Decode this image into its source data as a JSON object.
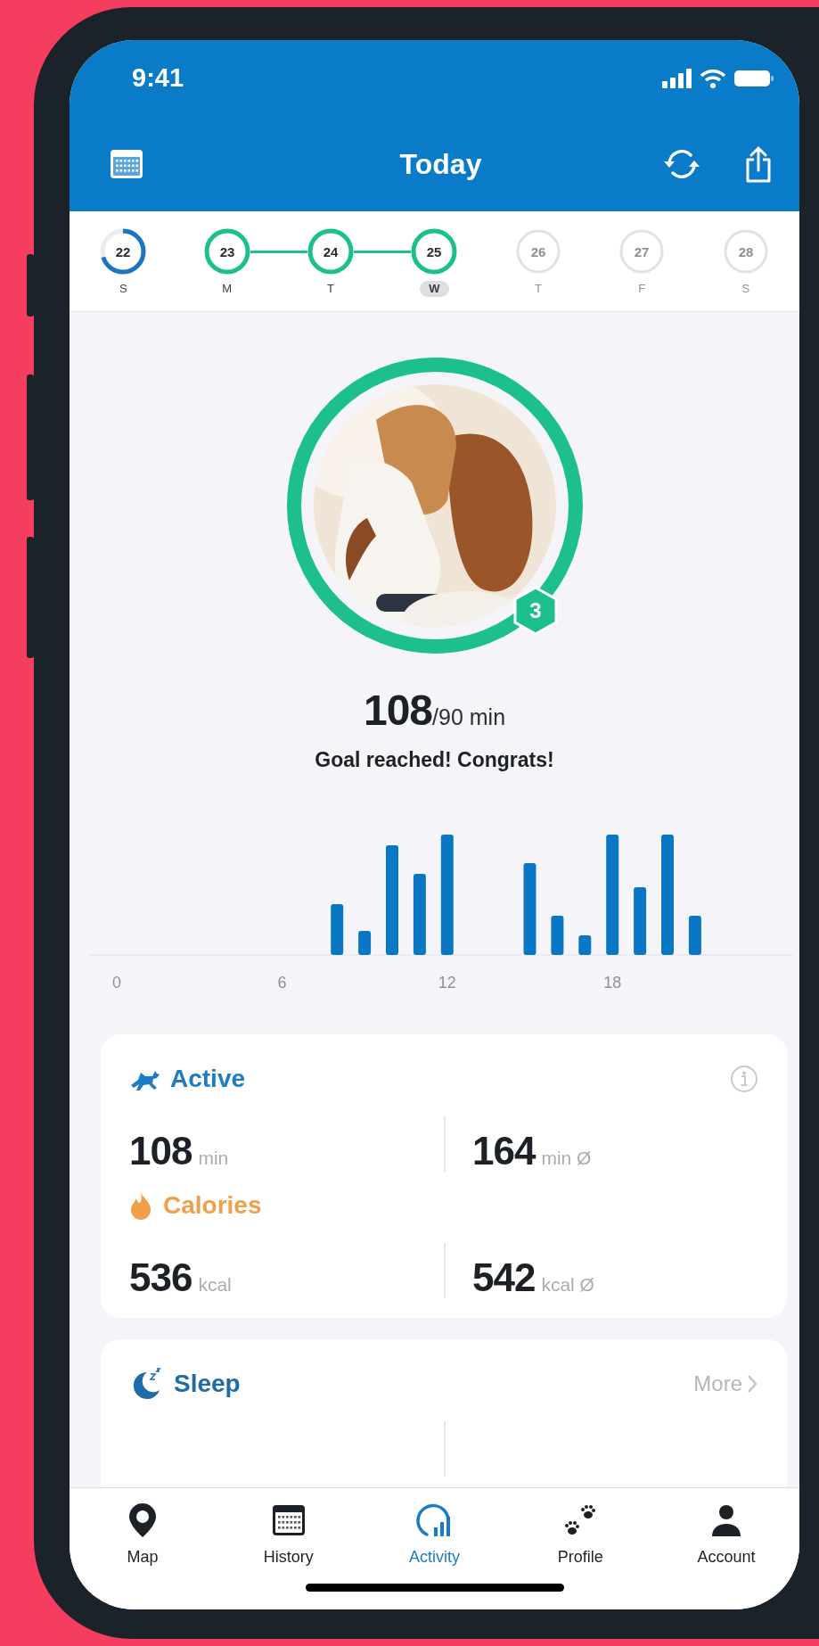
{
  "status_bar": {
    "time": "9:41"
  },
  "header": {
    "title": "Today"
  },
  "week": [
    {
      "date": "22",
      "weekday": "S",
      "kind": "partial",
      "level": 0.7,
      "selected": false
    },
    {
      "date": "23",
      "weekday": "M",
      "kind": "complete",
      "selected": false
    },
    {
      "date": "24",
      "weekday": "T",
      "kind": "complete",
      "selected": false
    },
    {
      "date": "25",
      "weekday": "W",
      "kind": "complete",
      "selected": true
    },
    {
      "date": "26",
      "weekday": "T",
      "kind": "future",
      "selected": false
    },
    {
      "date": "27",
      "weekday": "F",
      "kind": "future",
      "selected": false
    },
    {
      "date": "28",
      "weekday": "S",
      "kind": "future",
      "selected": false
    }
  ],
  "goal": {
    "level": 1,
    "badge": "3",
    "value": "108",
    "target": "/90 min",
    "message": "Goal reached! Congrats!"
  },
  "chart": {
    "axis_labels": [
      "0",
      "6",
      "12",
      "18"
    ]
  },
  "summary_card": {
    "sections": [
      {
        "kind": "active",
        "title": "Active",
        "color": "#1d7cc4",
        "stats": [
          {
            "value": "108",
            "unit": "min"
          },
          {
            "value": "164",
            "unit": "min Ø"
          }
        ]
      },
      {
        "kind": "calories",
        "title": "Calories",
        "color": "#f0a04b",
        "stats": [
          {
            "value": "536",
            "unit": "kcal"
          },
          {
            "value": "542",
            "unit": "kcal Ø"
          }
        ]
      }
    ]
  },
  "sleep_card": {
    "title": "Sleep",
    "link": "More"
  },
  "tab_bar": [
    {
      "label": "Map",
      "kind": "map",
      "selected": false
    },
    {
      "label": "History",
      "kind": "history",
      "selected": false
    },
    {
      "label": "Activity",
      "kind": "activity",
      "selected": true
    },
    {
      "label": "Profile",
      "kind": "profile",
      "selected": false
    },
    {
      "label": "Account",
      "kind": "account",
      "selected": false
    }
  ]
}
